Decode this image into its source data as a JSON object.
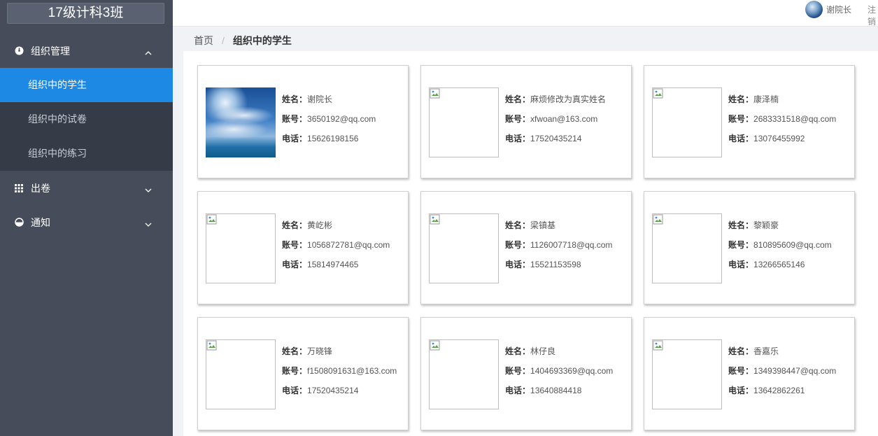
{
  "app": {
    "title": "17级计科3班"
  },
  "sidebar": {
    "group1": {
      "label": "组织管理",
      "icon": "dashboard-icon"
    },
    "sub": [
      {
        "label": "组织中的学生",
        "active": true
      },
      {
        "label": "组织中的试卷",
        "active": false
      },
      {
        "label": "组织中的练习",
        "active": false
      }
    ],
    "group2": {
      "label": "出卷",
      "icon": "grid-icon"
    },
    "group3": {
      "label": "通知",
      "icon": "pie-icon"
    }
  },
  "header": {
    "user_name": "谢院长",
    "logout": "注销"
  },
  "breadcrumb": {
    "home": "首页",
    "current": "组织中的学生"
  },
  "labels": {
    "name": "姓名：",
    "account": "账号：",
    "phone": "电话："
  },
  "students": [
    {
      "name": "谢院长",
      "account": "3650192@qq.com",
      "phone": "15626198156",
      "has_photo": true
    },
    {
      "name": "麻烦修改为真实姓名",
      "account": "xfwoan@163.com",
      "phone": "17520435214",
      "has_photo": false
    },
    {
      "name": "康泽楠",
      "account": "2683331518@qq.com",
      "phone": "13076455992",
      "has_photo": false
    },
    {
      "name": "黄屹彬",
      "account": "1056872781@qq.com",
      "phone": "15814974465",
      "has_photo": false
    },
    {
      "name": "梁镇基",
      "account": "1126007718@qq.com",
      "phone": "15521153598",
      "has_photo": false
    },
    {
      "name": "黎颖豪",
      "account": "810895609@qq.com",
      "phone": "13266565146",
      "has_photo": false
    },
    {
      "name": "万晓锋",
      "account": "f1508091631@163.com",
      "phone": "17520435214",
      "has_photo": false
    },
    {
      "name": "林仔良",
      "account": "1404693369@qq.com",
      "phone": "13640884418",
      "has_photo": false
    },
    {
      "name": "香嘉乐",
      "account": "1349398447@qq.com",
      "phone": "13642862261",
      "has_photo": false
    }
  ],
  "colors": {
    "sidebar_bg": "#464c59",
    "active_blue": "#1e88e5",
    "submenu_bg": "#363c47"
  }
}
